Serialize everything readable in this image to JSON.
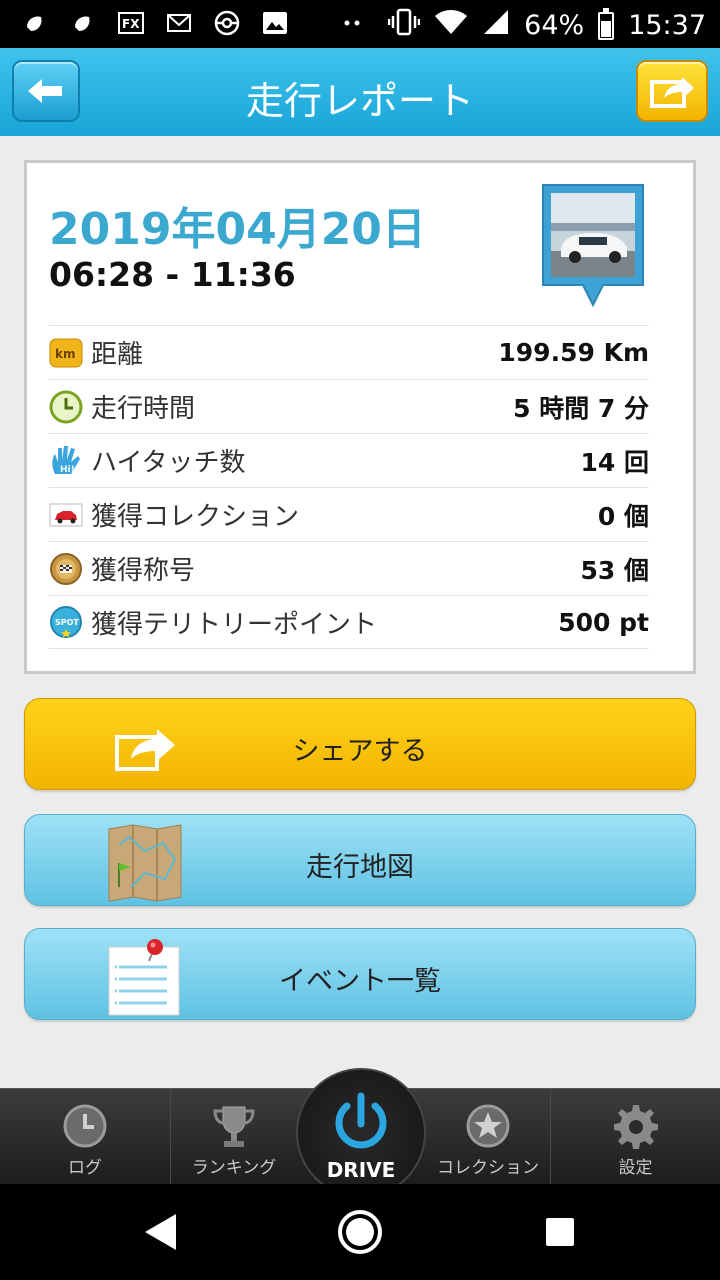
{
  "status_bar": {
    "battery": "64%",
    "time": "15:37",
    "icons": [
      "app-icon",
      "app-icon",
      "fx-icon",
      "mail-icon",
      "pokeball-icon",
      "image-icon",
      "more-dots-icon",
      "vibrate-icon",
      "wifi-icon",
      "signal-icon",
      "battery-icon"
    ]
  },
  "header": {
    "title": "走行レポート"
  },
  "report": {
    "date": "2019年04月20日",
    "time_range": "06:28 - 11:36",
    "stats": [
      {
        "icon": "km-icon",
        "label": "距離",
        "value": "199.59 Km"
      },
      {
        "icon": "clock-icon",
        "label": "走行時間",
        "value": "5 時間 7 分"
      },
      {
        "icon": "hi-five-icon",
        "label": "ハイタッチ数",
        "value": "14 回"
      },
      {
        "icon": "car-collection-icon",
        "label": "獲得コレクション",
        "value": "0 個"
      },
      {
        "icon": "medal-icon",
        "label": "獲得称号",
        "value": "53 個"
      },
      {
        "icon": "spot-icon",
        "label": "獲得テリトリーポイント",
        "value": "500 pt"
      }
    ]
  },
  "actions": {
    "share": "シェアする",
    "map": "走行地図",
    "events": "イベント一覧"
  },
  "tabs": {
    "log": "ログ",
    "ranking": "ランキング",
    "drive": "DRIVE",
    "collection": "コレクション",
    "settings": "設定"
  },
  "colors": {
    "header": "#18a5d8",
    "date": "#3ba8d0",
    "share_button": "#f2b400",
    "blue_button": "#5fc2e3",
    "drive_icon": "#2aa7e0"
  }
}
